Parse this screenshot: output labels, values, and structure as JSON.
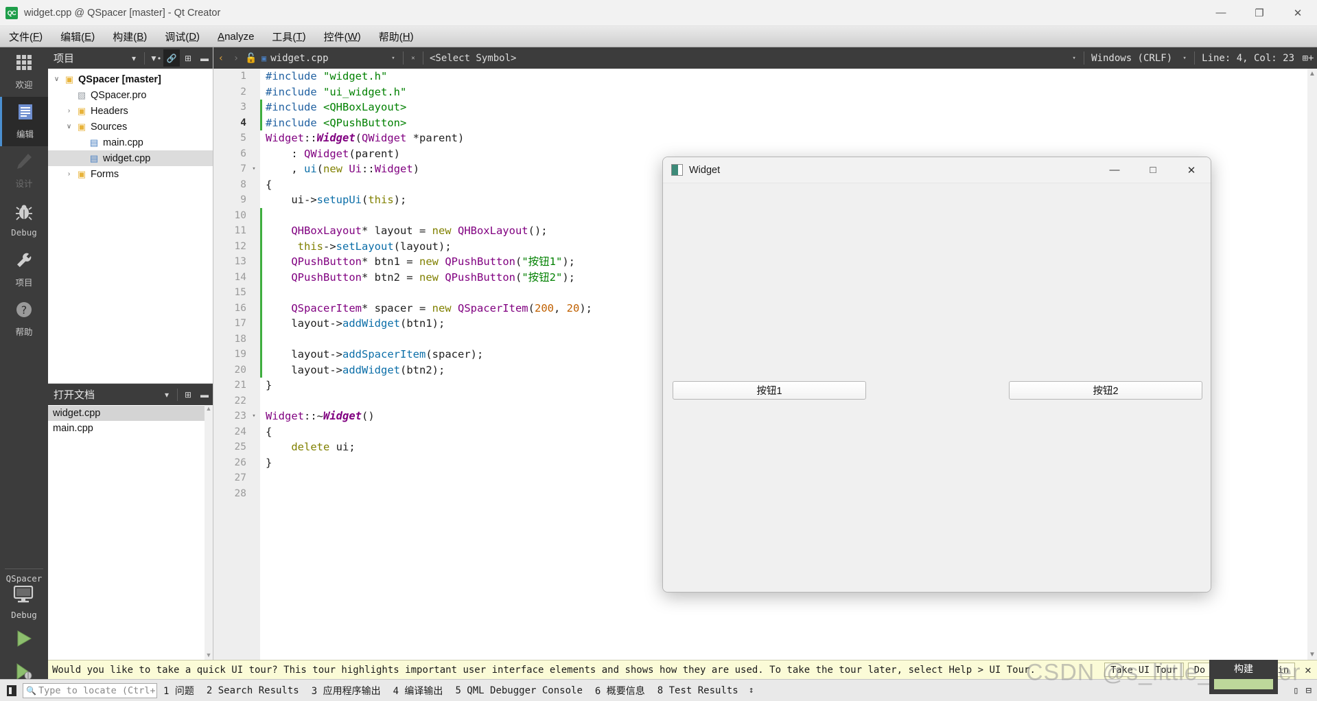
{
  "window": {
    "title": "widget.cpp @ QSpacer [master] - Qt Creator",
    "app_badge": "QC",
    "minimize": "—",
    "restore": "❐",
    "close": "✕"
  },
  "menubar": {
    "items": [
      {
        "label": "文件(F)",
        "key": "F"
      },
      {
        "label": "编辑(E)",
        "key": "E"
      },
      {
        "label": "构建(B)",
        "key": "B"
      },
      {
        "label": "调试(D)",
        "key": "D"
      },
      {
        "label": "Analyze",
        "key": "A"
      },
      {
        "label": "工具(T)",
        "key": "T"
      },
      {
        "label": "控件(W)",
        "key": "W"
      },
      {
        "label": "帮助(H)",
        "key": "H"
      }
    ]
  },
  "modebar": {
    "modes": [
      {
        "label": "欢迎",
        "icon": "grid-icon",
        "glyph": "░",
        "state": "normal"
      },
      {
        "label": "编辑",
        "icon": "document-icon",
        "glyph": "☰",
        "state": "active"
      },
      {
        "label": "设计",
        "icon": "pencil-icon",
        "glyph": "✎",
        "state": "dim"
      },
      {
        "label": "Debug",
        "icon": "bug-icon",
        "glyph": "❦",
        "state": "normal"
      },
      {
        "label": "项目",
        "icon": "wrench-icon",
        "glyph": "⚒",
        "state": "normal"
      },
      {
        "label": "帮助",
        "icon": "help-icon",
        "glyph": "❓",
        "state": "normal"
      }
    ],
    "kit_name": "QSpacer",
    "kit_icon": "desktop-icon",
    "build_config": "Debug",
    "run_button": "run-icon",
    "debug_button": "debug-run-icon"
  },
  "project_panel": {
    "title": "项目",
    "toolbar": [
      "filter-icon",
      "link-icon",
      "split-icon",
      "close-icon"
    ],
    "tree": [
      {
        "label": "QSpacer [master]",
        "indent": 0,
        "arrow": "∨",
        "icon": "folder-project-icon",
        "bold": true,
        "selected": false
      },
      {
        "label": "QSpacer.pro",
        "indent": 1,
        "arrow": "",
        "icon": "pro-file-icon",
        "bold": false,
        "selected": false
      },
      {
        "label": "Headers",
        "indent": 1,
        "arrow": "›",
        "icon": "folder-h-icon",
        "bold": false,
        "selected": false
      },
      {
        "label": "Sources",
        "indent": 1,
        "arrow": "∨",
        "icon": "folder-cpp-icon",
        "bold": false,
        "selected": false
      },
      {
        "label": "main.cpp",
        "indent": 2,
        "arrow": "",
        "icon": "cpp-file-icon",
        "bold": false,
        "selected": false
      },
      {
        "label": "widget.cpp",
        "indent": 2,
        "arrow": "",
        "icon": "cpp-file-icon",
        "bold": false,
        "selected": true
      },
      {
        "label": "Forms",
        "indent": 1,
        "arrow": "›",
        "icon": "folder-forms-icon",
        "bold": false,
        "selected": false
      }
    ]
  },
  "open_documents": {
    "title": "打开文档",
    "toolbar": [
      "split-icon",
      "close-icon"
    ],
    "items": [
      {
        "label": "main.cpp",
        "selected": false
      },
      {
        "label": "widget.cpp",
        "selected": true
      }
    ]
  },
  "editor_toolbar": {
    "back": "‹",
    "forward": "›",
    "lock": "lock-open-icon",
    "file_icon": "cpp-file-icon",
    "file_name": "widget.cpp",
    "dropdown": "▾",
    "close": "✕",
    "symbol_selector": "<Select Symbol>",
    "line_ending": "Windows (CRLF)",
    "cursor_position": "Line: 4, Col: 23",
    "split_icon": "split-editor-icon"
  },
  "code": {
    "lines": [
      {
        "n": 1,
        "fold": "",
        "mark": false,
        "cur": false,
        "tokens": [
          {
            "t": "#include ",
            "c": "pre"
          },
          {
            "t": "\"widget.h\"",
            "c": "str"
          }
        ]
      },
      {
        "n": 2,
        "fold": "",
        "mark": false,
        "cur": false,
        "tokens": [
          {
            "t": "#include ",
            "c": "pre"
          },
          {
            "t": "\"ui_widget.h\"",
            "c": "str"
          }
        ]
      },
      {
        "n": 3,
        "fold": "",
        "mark": true,
        "cur": false,
        "tokens": [
          {
            "t": "#include ",
            "c": "pre"
          },
          {
            "t": "<QHBoxLayout>",
            "c": "str"
          }
        ]
      },
      {
        "n": 4,
        "fold": "",
        "mark": true,
        "cur": true,
        "tokens": [
          {
            "t": "#include ",
            "c": "pre"
          },
          {
            "t": "<QPushButton>",
            "c": "str"
          }
        ]
      },
      {
        "n": 5,
        "fold": "",
        "mark": false,
        "cur": false,
        "tokens": [
          {
            "t": "Widget",
            "c": "cls2"
          },
          {
            "t": "::",
            "c": "pun"
          },
          {
            "t": "Widget",
            "c": "cls"
          },
          {
            "t": "(",
            "c": "pun"
          },
          {
            "t": "QWidget",
            "c": "cls2"
          },
          {
            "t": " *parent)",
            "c": "pun"
          }
        ]
      },
      {
        "n": 6,
        "fold": "",
        "mark": false,
        "cur": false,
        "tokens": [
          {
            "t": "    : ",
            "c": "pun"
          },
          {
            "t": "QWidget",
            "c": "cls2"
          },
          {
            "t": "(parent)",
            "c": "pun"
          }
        ]
      },
      {
        "n": 7,
        "fold": "▾",
        "mark": false,
        "cur": false,
        "tokens": [
          {
            "t": "    , ",
            "c": "pun"
          },
          {
            "t": "ui",
            "c": "fn"
          },
          {
            "t": "(",
            "c": "pun"
          },
          {
            "t": "new",
            "c": "kw"
          },
          {
            "t": " ",
            "c": "pun"
          },
          {
            "t": "Ui",
            "c": "cls2"
          },
          {
            "t": "::",
            "c": "pun"
          },
          {
            "t": "Widget",
            "c": "cls2"
          },
          {
            "t": ")",
            "c": "pun"
          }
        ]
      },
      {
        "n": 8,
        "fold": "",
        "mark": false,
        "cur": false,
        "tokens": [
          {
            "t": "{",
            "c": "pun"
          }
        ]
      },
      {
        "n": 9,
        "fold": "",
        "mark": false,
        "cur": false,
        "tokens": [
          {
            "t": "    ui",
            "c": "var"
          },
          {
            "t": "->",
            "c": "pun"
          },
          {
            "t": "setupUi",
            "c": "fn"
          },
          {
            "t": "(",
            "c": "pun"
          },
          {
            "t": "this",
            "c": "kw"
          },
          {
            "t": ");",
            "c": "pun"
          }
        ]
      },
      {
        "n": 10,
        "fold": "",
        "mark": true,
        "cur": false,
        "tokens": [
          {
            "t": "",
            "c": "pun"
          }
        ]
      },
      {
        "n": 11,
        "fold": "",
        "mark": true,
        "cur": false,
        "tokens": [
          {
            "t": "    ",
            "c": "pun"
          },
          {
            "t": "QHBoxLayout",
            "c": "cls2"
          },
          {
            "t": "* layout = ",
            "c": "pun"
          },
          {
            "t": "new",
            "c": "kw"
          },
          {
            "t": " ",
            "c": "pun"
          },
          {
            "t": "QHBoxLayout",
            "c": "cls2"
          },
          {
            "t": "();",
            "c": "pun"
          }
        ]
      },
      {
        "n": 12,
        "fold": "",
        "mark": true,
        "cur": false,
        "tokens": [
          {
            "t": "     ",
            "c": "pun"
          },
          {
            "t": "this",
            "c": "kw"
          },
          {
            "t": "->",
            "c": "pun"
          },
          {
            "t": "setLayout",
            "c": "fn"
          },
          {
            "t": "(layout);",
            "c": "pun"
          }
        ]
      },
      {
        "n": 13,
        "fold": "",
        "mark": true,
        "cur": false,
        "tokens": [
          {
            "t": "    ",
            "c": "pun"
          },
          {
            "t": "QPushButton",
            "c": "cls2"
          },
          {
            "t": "* btn1 = ",
            "c": "pun"
          },
          {
            "t": "new",
            "c": "kw"
          },
          {
            "t": " ",
            "c": "pun"
          },
          {
            "t": "QPushButton",
            "c": "cls2"
          },
          {
            "t": "(",
            "c": "pun"
          },
          {
            "t": "\"按钮1\"",
            "c": "str"
          },
          {
            "t": ");",
            "c": "pun"
          }
        ]
      },
      {
        "n": 14,
        "fold": "",
        "mark": true,
        "cur": false,
        "tokens": [
          {
            "t": "    ",
            "c": "pun"
          },
          {
            "t": "QPushButton",
            "c": "cls2"
          },
          {
            "t": "* btn2 = ",
            "c": "pun"
          },
          {
            "t": "new",
            "c": "kw"
          },
          {
            "t": " ",
            "c": "pun"
          },
          {
            "t": "QPushButton",
            "c": "cls2"
          },
          {
            "t": "(",
            "c": "pun"
          },
          {
            "t": "\"按钮2\"",
            "c": "str"
          },
          {
            "t": ");",
            "c": "pun"
          }
        ]
      },
      {
        "n": 15,
        "fold": "",
        "mark": true,
        "cur": false,
        "tokens": [
          {
            "t": "",
            "c": "pun"
          }
        ]
      },
      {
        "n": 16,
        "fold": "",
        "mark": true,
        "cur": false,
        "tokens": [
          {
            "t": "    ",
            "c": "pun"
          },
          {
            "t": "QSpacerItem",
            "c": "cls2"
          },
          {
            "t": "* spacer = ",
            "c": "pun"
          },
          {
            "t": "new",
            "c": "kw"
          },
          {
            "t": " ",
            "c": "pun"
          },
          {
            "t": "QSpacerItem",
            "c": "cls2"
          },
          {
            "t": "(",
            "c": "pun"
          },
          {
            "t": "200",
            "c": "num"
          },
          {
            "t": ", ",
            "c": "pun"
          },
          {
            "t": "20",
            "c": "num"
          },
          {
            "t": ");",
            "c": "pun"
          }
        ]
      },
      {
        "n": 17,
        "fold": "",
        "mark": true,
        "cur": false,
        "tokens": [
          {
            "t": "    layout",
            "c": "var"
          },
          {
            "t": "->",
            "c": "pun"
          },
          {
            "t": "addWidget",
            "c": "fn"
          },
          {
            "t": "(btn1);",
            "c": "pun"
          }
        ]
      },
      {
        "n": 18,
        "fold": "",
        "mark": true,
        "cur": false,
        "tokens": [
          {
            "t": "",
            "c": "pun"
          }
        ]
      },
      {
        "n": 19,
        "fold": "",
        "mark": true,
        "cur": false,
        "tokens": [
          {
            "t": "    layout",
            "c": "var"
          },
          {
            "t": "->",
            "c": "pun"
          },
          {
            "t": "addSpacerItem",
            "c": "fn"
          },
          {
            "t": "(spacer);",
            "c": "pun"
          }
        ]
      },
      {
        "n": 20,
        "fold": "",
        "mark": true,
        "cur": false,
        "tokens": [
          {
            "t": "    layout",
            "c": "var"
          },
          {
            "t": "->",
            "c": "pun"
          },
          {
            "t": "addWidget",
            "c": "fn"
          },
          {
            "t": "(btn2);",
            "c": "pun"
          }
        ]
      },
      {
        "n": 21,
        "fold": "",
        "mark": false,
        "cur": false,
        "tokens": [
          {
            "t": "}",
            "c": "pun"
          }
        ]
      },
      {
        "n": 22,
        "fold": "",
        "mark": false,
        "cur": false,
        "tokens": [
          {
            "t": "",
            "c": "pun"
          }
        ]
      },
      {
        "n": 23,
        "fold": "▾",
        "mark": false,
        "cur": false,
        "tokens": [
          {
            "t": "Widget",
            "c": "cls2"
          },
          {
            "t": "::~",
            "c": "pun"
          },
          {
            "t": "Widget",
            "c": "cls"
          },
          {
            "t": "()",
            "c": "pun"
          }
        ]
      },
      {
        "n": 24,
        "fold": "",
        "mark": false,
        "cur": false,
        "tokens": [
          {
            "t": "{",
            "c": "pun"
          }
        ]
      },
      {
        "n": 25,
        "fold": "",
        "mark": false,
        "cur": false,
        "tokens": [
          {
            "t": "    ",
            "c": "pun"
          },
          {
            "t": "delete",
            "c": "kw"
          },
          {
            "t": " ui;",
            "c": "var"
          }
        ]
      },
      {
        "n": 26,
        "fold": "",
        "mark": false,
        "cur": false,
        "tokens": [
          {
            "t": "}",
            "c": "pun"
          }
        ]
      },
      {
        "n": 27,
        "fold": "",
        "mark": false,
        "cur": false,
        "tokens": [
          {
            "t": "",
            "c": "pun"
          }
        ]
      },
      {
        "n": 28,
        "fold": "",
        "mark": false,
        "cur": false,
        "tokens": [
          {
            "t": "",
            "c": "pun"
          }
        ]
      }
    ]
  },
  "widget_dialog": {
    "title": "Widget",
    "icon": "widget-app-icon",
    "minimize": "—",
    "maximize": "□",
    "close": "✕",
    "buttons": [
      {
        "label": "按钮1",
        "name": "btn1"
      },
      {
        "label": "按钮2",
        "name": "btn2"
      }
    ]
  },
  "notification": {
    "message": "Would you like to take a quick UI tour? This tour highlights important user interface elements and shows how they are used. To take the tour later, select Help > UI Tour.",
    "buttons": [
      "Take UI Tour",
      "Do Not Show Again"
    ],
    "close": "✕"
  },
  "statusbar": {
    "locate_placeholder": "Type to locate (Ctrl+...",
    "search_icon": "magnifier-icon",
    "panes": [
      "1 问题",
      "2 Search Results",
      "3 应用程序输出",
      "4 编译输出",
      "5 QML Debugger Console",
      "6 概要信息",
      "8 Test Results"
    ],
    "updown": "↕",
    "right_icons": [
      "minimize-pane-icon",
      "maximize-pane-icon"
    ]
  },
  "build_tooltip": {
    "label": "构建",
    "progress": 100
  },
  "watermark": "CSDN @s_little_monster",
  "colors": {
    "accent": "#4a8fd0",
    "dark_chrome": "#3c3c3c",
    "notify_bg": "#fbfbd7",
    "selection": "#dcdcdc",
    "green_marker": "#3fae3f"
  }
}
